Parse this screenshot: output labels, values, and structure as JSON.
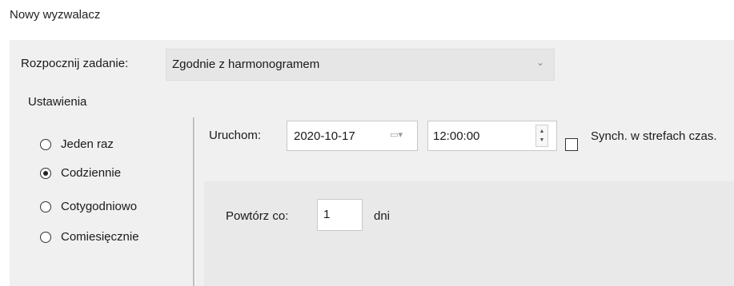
{
  "dialog": {
    "title": "Nowy wyzwalacz"
  },
  "start_task": {
    "label": "Rozpocznij zadanie:",
    "selected": "Zgodnie z harmonogramem",
    "chevron_icon": "chevron-down-icon"
  },
  "settings": {
    "group_label": "Ustawienia",
    "options": [
      {
        "label": "Jeden raz",
        "checked": false
      },
      {
        "label": "Codziennie",
        "checked": true
      },
      {
        "label": "Cotygodniowo",
        "checked": false
      },
      {
        "label": "Comiesięcznie",
        "checked": false
      }
    ],
    "run": {
      "label": "Uruchom:",
      "date": "2020-10-17",
      "time": "12:00:00",
      "calendar_icon": "calendar-icon"
    },
    "sync": {
      "label": "Synch. w strefach czas.",
      "checked": false
    },
    "repeat": {
      "label": "Powtórz co:",
      "value": "1",
      "unit": "dni"
    }
  }
}
